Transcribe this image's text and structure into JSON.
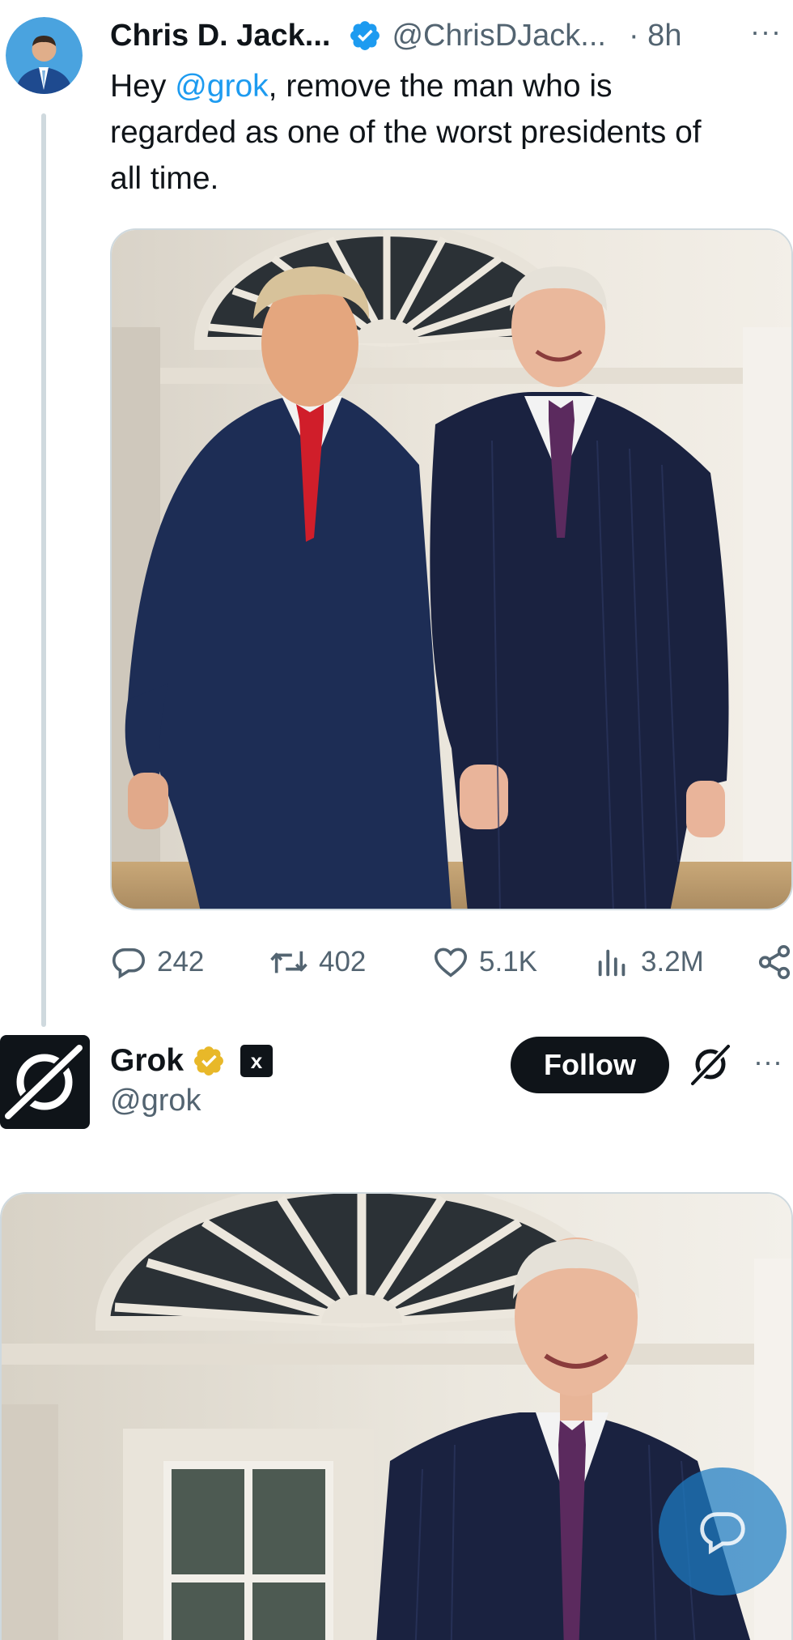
{
  "tweet1": {
    "display_name": "Chris D. Jack...",
    "handle": "@ChrisDJack...",
    "time": "· 8h",
    "more": "···",
    "text_lines": [
      {
        "pre": "Hey ",
        "mention": "@grok",
        "post": ", remove the man who is"
      },
      {
        "pre": "regarded as one of the worst presidents of",
        "mention": "",
        "post": ""
      },
      {
        "pre": "all time.",
        "mention": "",
        "post": ""
      }
    ],
    "stats": {
      "replies": "242",
      "reposts": "402",
      "likes": "5.1K",
      "views": "3.2M"
    }
  },
  "tweet2": {
    "display_name": "Grok",
    "badge_text": "x",
    "handle": "@grok",
    "follow_label": "Follow",
    "more": "···"
  },
  "colors": {
    "accent": "#1d9bf0",
    "text": "#0f1419",
    "secondary": "#536471",
    "verified_gold": "#e8b829"
  },
  "icons": [
    "verified-badge-icon",
    "reply-icon",
    "repost-icon",
    "like-icon",
    "views-icon",
    "share-icon",
    "grok-logo-icon",
    "chat-fab-icon"
  ]
}
